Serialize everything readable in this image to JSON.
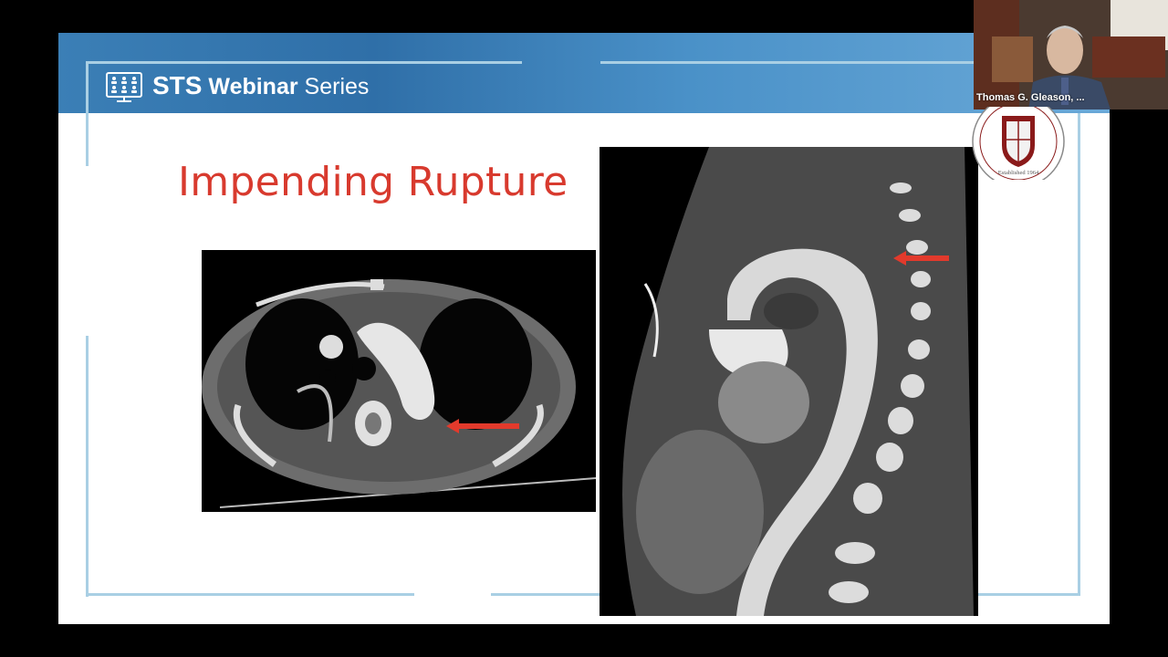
{
  "slide": {
    "series_brand": {
      "strong": "STS",
      "bold": "Webinar",
      "regular": "Series"
    },
    "title": "Impending Rupture",
    "images": {
      "axial": "axial-ct-scan-chest",
      "sagittal": "sagittal-ct-scan-aorta"
    }
  },
  "video": {
    "participant_name": "Thomas G. Gleason, ..."
  },
  "seal": {
    "text": "Established 1964"
  },
  "colors": {
    "banner": "#3b7fb6",
    "title": "#d83a2e",
    "arrow": "#e23a2c",
    "frame": "#a9cfe4"
  }
}
